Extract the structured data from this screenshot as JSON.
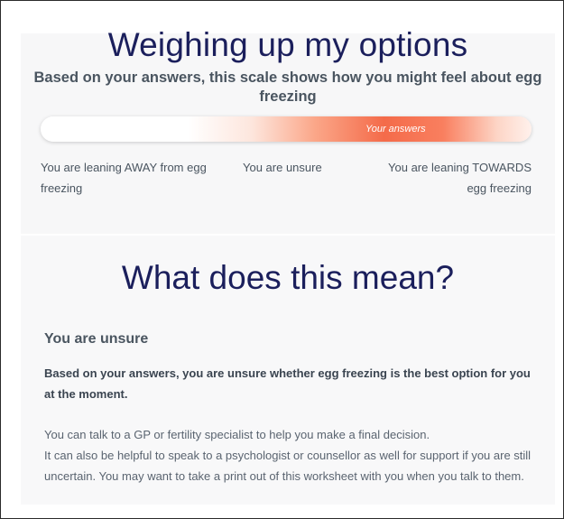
{
  "scale_section": {
    "title": "Weighing up my options",
    "subtitle": "Based on your answers, this scale shows how you might feel about egg freezing",
    "scale_marker_label": "Your answers",
    "scale_position": "unsure-to-towards",
    "label_away": "You are leaning AWAY from egg freezing",
    "label_unsure": "You are unsure",
    "label_towards": "You are leaning TOWARDS egg freezing",
    "colors": {
      "title": "#1b1f5c",
      "scale_accent": "#f46b4a",
      "text": "#4a5560"
    }
  },
  "meaning_section": {
    "title": "What does this mean?",
    "result_heading": "You are unsure",
    "result_summary": "Based on your answers, you are unsure whether egg freezing is the best option for you at the moment.",
    "body_line_1": "You can talk to a GP or fertility specialist to help you make a final decision.",
    "body_line_2": "It can also be helpful to speak to a psychologist or counsellor as well for support if you are still uncertain. You may want to take a print out of this worksheet with you when you talk to them."
  }
}
